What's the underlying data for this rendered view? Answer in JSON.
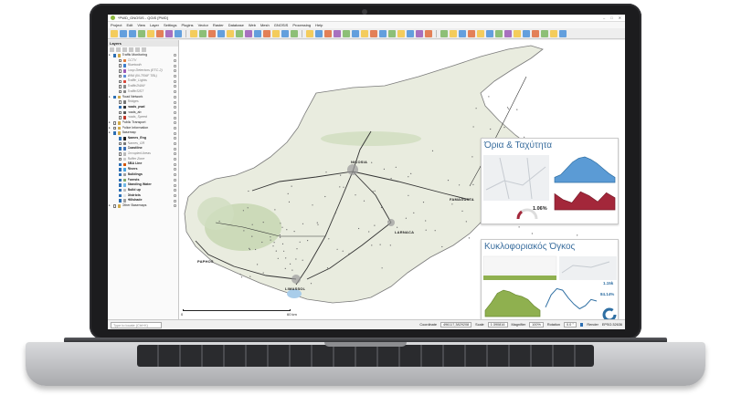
{
  "window": {
    "title": "*PWD_GNOSIS - QGIS [PWD]",
    "controls": [
      "–",
      "□",
      "✕"
    ]
  },
  "menu": [
    "Project",
    "Edit",
    "View",
    "Layer",
    "Settings",
    "Plugins",
    "Vector",
    "Raster",
    "Database",
    "Web",
    "Mesh",
    "GNOSIS",
    "Processing",
    "Help"
  ],
  "layers_panel": {
    "title": "Layers",
    "rows": [
      {
        "label": "Traffic Monitoring",
        "indent": 0,
        "group": true,
        "checked": true,
        "style": "normal"
      },
      {
        "label": "CCTV",
        "indent": 2,
        "checked": false,
        "style": "italic",
        "icon": "#e07b39"
      },
      {
        "label": "Bluetooth",
        "indent": 2,
        "checked": false,
        "style": "italic",
        "icon": "#3d7ecb"
      },
      {
        "label": "Loop Detectors (ETC-2)",
        "indent": 2,
        "checked": false,
        "style": "italic",
        "icon": "#9b59b6"
      },
      {
        "label": "WIM (IN-TRAF TBL)",
        "indent": 2,
        "checked": false,
        "style": "italic",
        "icon": "#5b8dd6"
      },
      {
        "label": "Traffic_Lights",
        "indent": 2,
        "checked": false,
        "style": "italic",
        "icon": "#d9473a"
      },
      {
        "label": "Traffic2WAY",
        "indent": 2,
        "checked": false,
        "style": "italic",
        "icon": "#888888"
      },
      {
        "label": "TrafficSIST",
        "indent": 2,
        "checked": false,
        "style": "italic",
        "icon": "#888888"
      },
      {
        "label": "Road Network",
        "indent": 0,
        "group": true,
        "checked": true,
        "style": "normal"
      },
      {
        "label": "Bridges",
        "indent": 2,
        "checked": false,
        "style": "italic",
        "icon": "#777777"
      },
      {
        "label": "roads_pwd",
        "indent": 2,
        "checked": true,
        "style": "bold",
        "icon": "#333333"
      },
      {
        "label": "roads_ab",
        "indent": 2,
        "checked": false,
        "style": "normal",
        "icon": "#555555"
      },
      {
        "label": "roads_Speed",
        "indent": 2,
        "checked": false,
        "style": "italic",
        "icon": "#c0392b"
      },
      {
        "label": "Public Transport",
        "indent": 0,
        "group": true,
        "checked": false,
        "style": "normal"
      },
      {
        "label": "Police Information",
        "indent": 0,
        "group": true,
        "checked": false,
        "style": "normal"
      },
      {
        "label": "Basemap",
        "indent": 0,
        "group": true,
        "checked": true,
        "style": "normal"
      },
      {
        "label": "Names_Eng",
        "indent": 2,
        "checked": true,
        "style": "bold",
        "icon": "#222222"
      },
      {
        "label": "Names_GR",
        "indent": 2,
        "checked": false,
        "style": "italic",
        "icon": "#777777"
      },
      {
        "label": "Coastline",
        "indent": 2,
        "checked": true,
        "style": "bold",
        "icon": "#3d6fb3"
      },
      {
        "label": "Occupied Areas",
        "indent": 2,
        "checked": false,
        "style": "italic",
        "icon": "#bbbbbb"
      },
      {
        "label": "Buffer Zone",
        "indent": 2,
        "checked": false,
        "style": "italic",
        "icon": "#cccccc"
      },
      {
        "label": "SBA Line",
        "indent": 2,
        "checked": true,
        "style": "bold",
        "icon": "#d35400"
      },
      {
        "label": "Rivers",
        "indent": 2,
        "checked": true,
        "style": "bold",
        "icon": "#4aa3df"
      },
      {
        "label": "Buildings",
        "indent": 2,
        "checked": true,
        "style": "bold",
        "icon": "#9e9e9e"
      },
      {
        "label": "Forests",
        "indent": 2,
        "checked": true,
        "style": "bold",
        "icon": "#7fa86a"
      },
      {
        "label": "Standing Water",
        "indent": 2,
        "checked": true,
        "style": "bold",
        "icon": "#6fb7e6"
      },
      {
        "label": "Build up",
        "indent": 2,
        "checked": true,
        "style": "bold",
        "icon": "#bdbdbd"
      },
      {
        "label": "Districts",
        "indent": 2,
        "checked": true,
        "style": "bold",
        "icon": "#e8e8e8"
      },
      {
        "label": "Hillshade",
        "indent": 2,
        "checked": true,
        "style": "bold",
        "icon": "#a0a0a0"
      },
      {
        "label": "Other Basemaps",
        "indent": 0,
        "group": true,
        "checked": false,
        "style": "normal"
      }
    ]
  },
  "map": {
    "cities": {
      "nicosia": "NICOSIA",
      "famagusta": "FAMAGUSTA",
      "larnaca": "LARNACA",
      "limassol": "LIMASSOL",
      "paphos": "PAPHOS"
    },
    "scale": {
      "start": "0",
      "end": "60 km"
    },
    "credit": "© GNOSIS | PWD Project",
    "colors": {
      "land": "#e9ecdf",
      "forest": "#c9d8b5",
      "roads": "#333333",
      "sea": "#ffffff"
    }
  },
  "dashboard_speed": {
    "title": "Όρια & Ταχύτητα",
    "gauge_value": "1.06%",
    "accent_blue": "#5b9bd5",
    "accent_red": "#a3273a",
    "speed_area": [
      0.2,
      0.3,
      0.55,
      0.8,
      0.95,
      1.0,
      0.9,
      0.75,
      0.55,
      0.35,
      0.2
    ],
    "red_bars": [
      0.8,
      0.5,
      0.35,
      0.9,
      0.7,
      0.4,
      0.85,
      0.6
    ]
  },
  "dashboard_volume": {
    "title": "Κυκλοφοριακός Όγκος",
    "kpi_value": "1.15k",
    "kpi_pct": "84.14%",
    "accent_green": "#8fb04f",
    "volume_area": [
      0.2,
      0.45,
      0.75,
      0.85,
      0.8,
      0.7,
      0.65,
      0.55,
      0.35,
      0.2
    ],
    "volume_line": [
      0.3,
      0.7,
      0.9,
      0.85,
      0.6,
      0.4,
      0.25,
      0.35,
      0.55,
      0.5
    ]
  },
  "statusbar": {
    "locator_placeholder": "Type to locate (Ctrl+K)",
    "coordinate_label": "Coordinate",
    "coordinate_value": "496117,3829208",
    "scale_label": "Scale",
    "scale_value": "1:390816",
    "magnifier_label": "Magnifier",
    "magnifier_value": "100%",
    "rotation_label": "Rotation",
    "rotation_value": "0.0 °",
    "render_label": "Render",
    "crs": "EPSG:32636"
  }
}
